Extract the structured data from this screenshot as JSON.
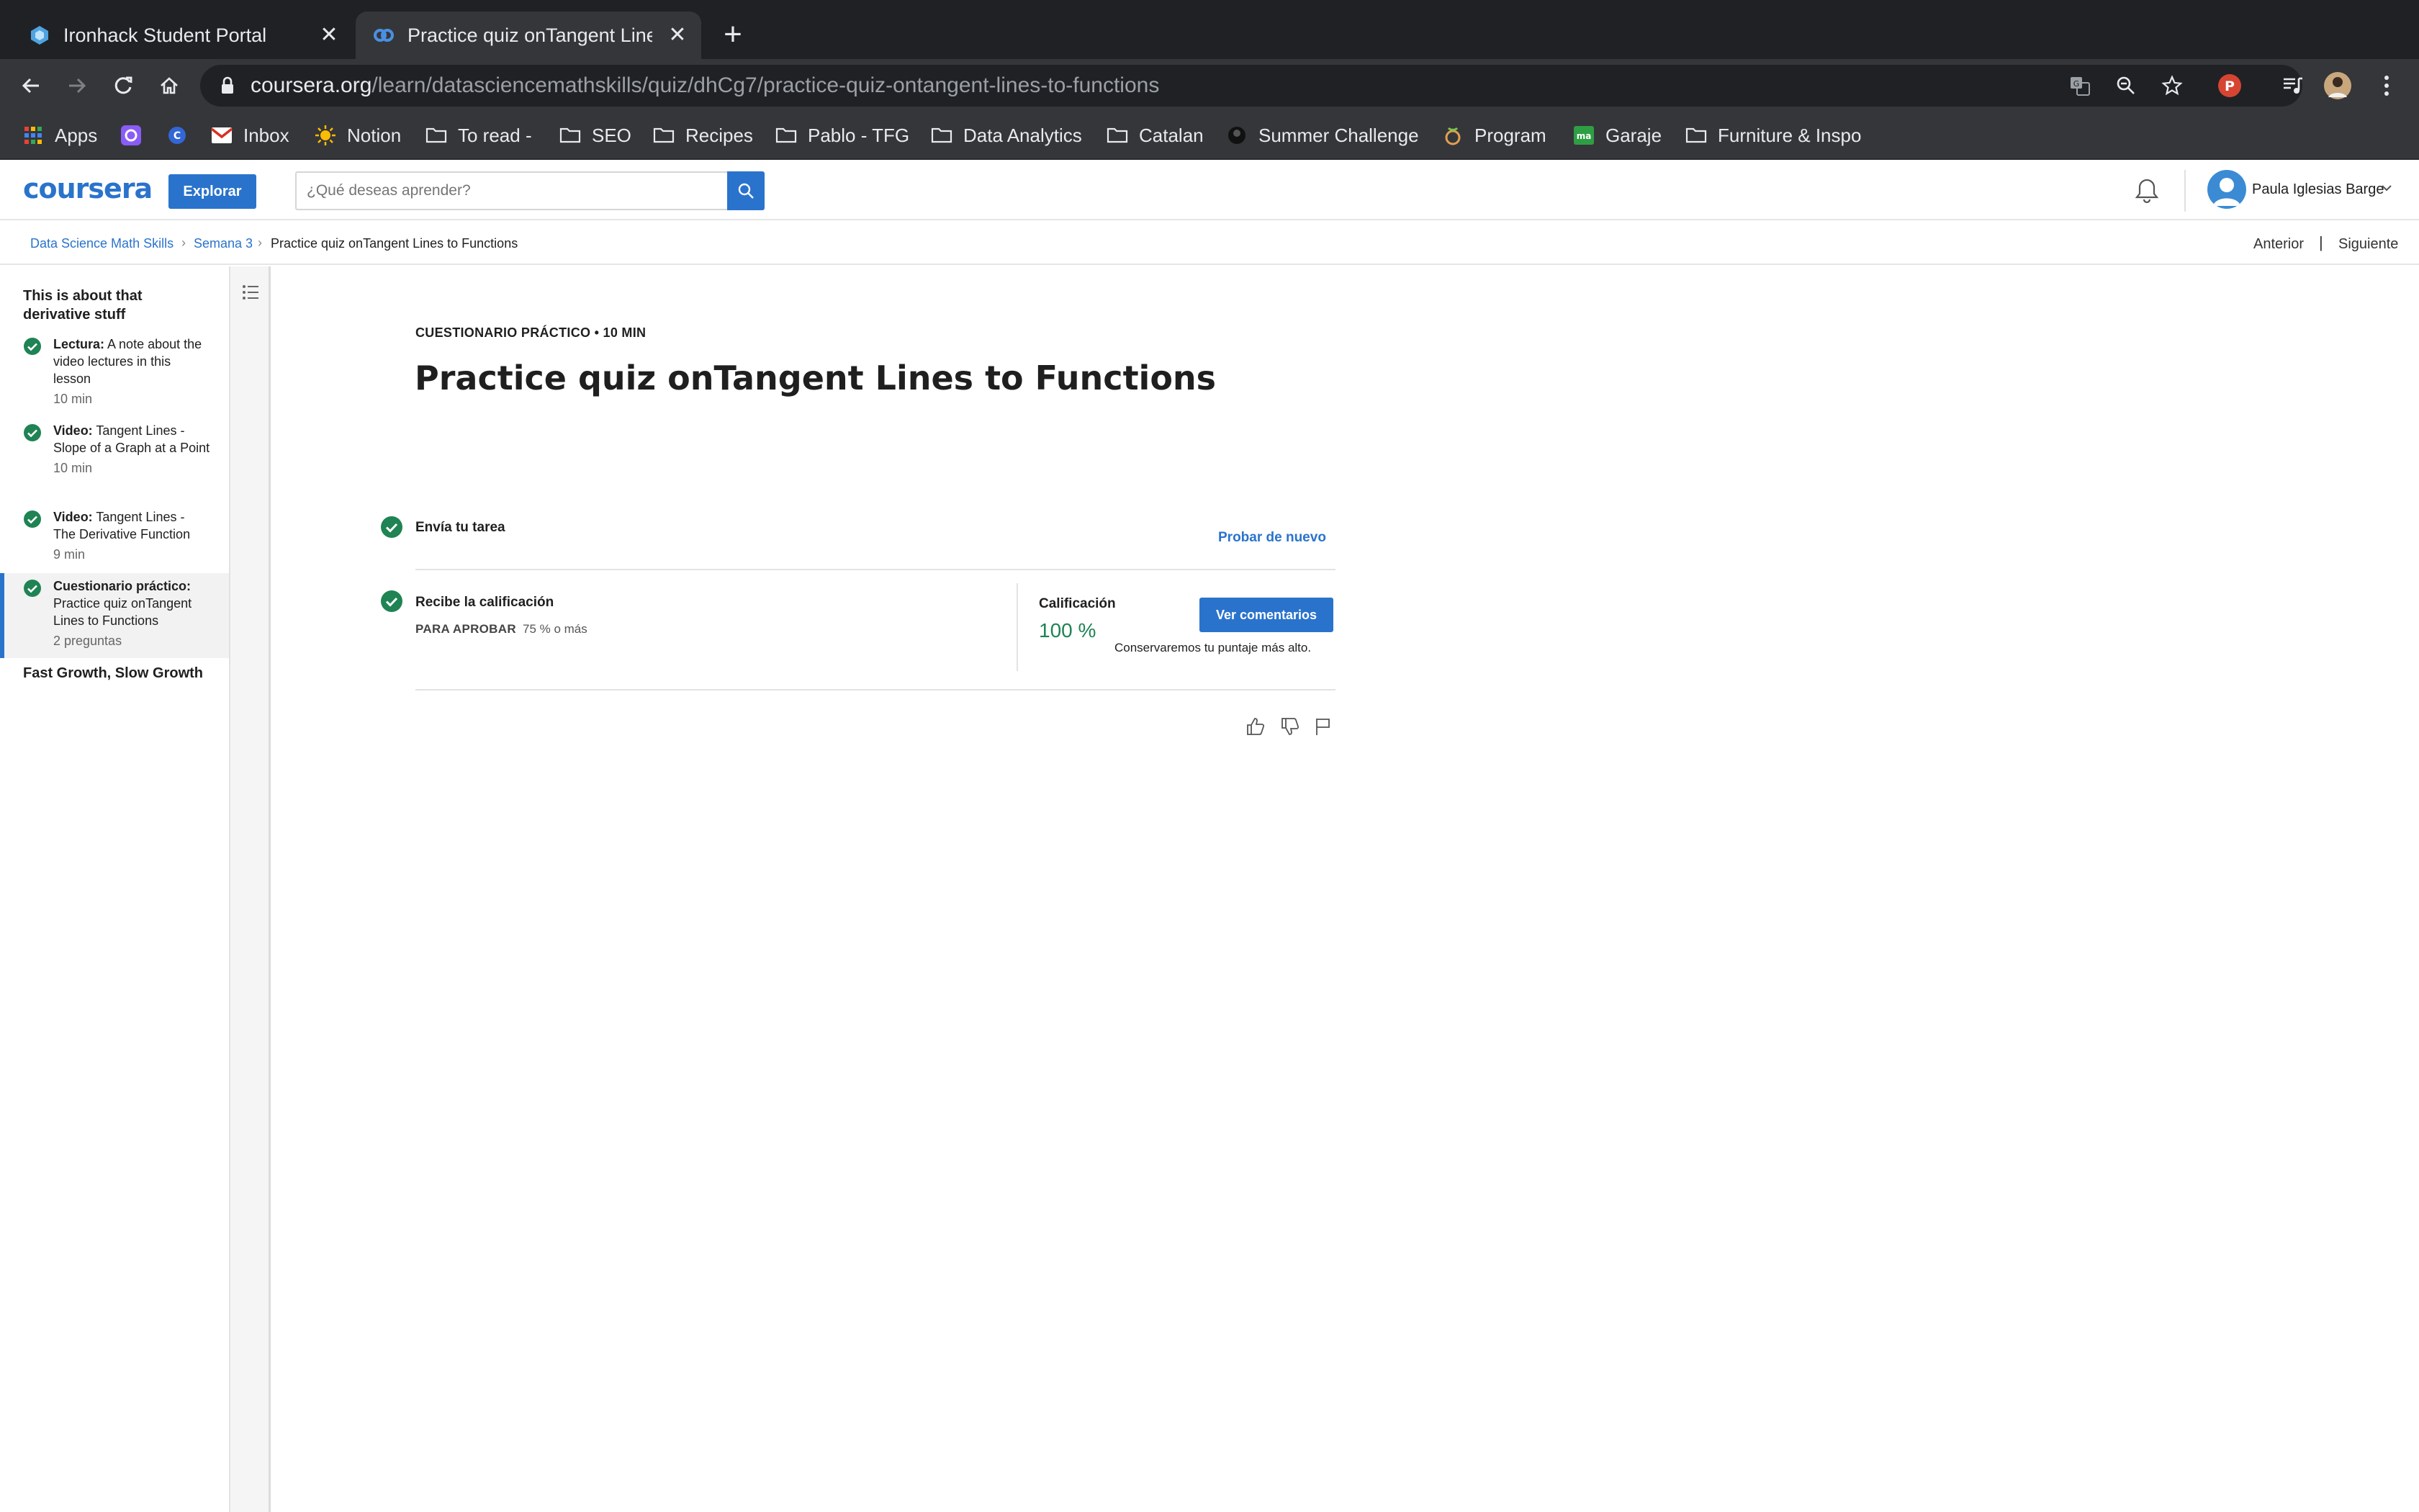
{
  "browser": {
    "tabs": [
      {
        "title": "Ironhack Student Portal",
        "active": false
      },
      {
        "title": "Practice quiz onTangent Lines to Functions",
        "active": true
      }
    ],
    "url_host": "coursera.org",
    "url_path": "/learn/datasciencemathskills/quiz/dhCg7/practice-quiz-ontangent-lines-to-functions",
    "profile_initial": "P",
    "bookmarks": [
      {
        "label": "Apps",
        "icon": "apps-grid-icon"
      },
      {
        "label": "",
        "icon": "app-icon"
      },
      {
        "label": "",
        "icon": "app-icon"
      },
      {
        "label": "Inbox",
        "icon": "gmail-icon"
      },
      {
        "label": "Notion",
        "icon": "sun-icon"
      },
      {
        "label": "To read -",
        "icon": "folder-icon"
      },
      {
        "label": "SEO",
        "icon": "folder-icon"
      },
      {
        "label": "Recipes",
        "icon": "folder-icon"
      },
      {
        "label": "Pablo - TFG",
        "icon": "folder-icon"
      },
      {
        "label": "Data Analytics",
        "icon": "folder-icon"
      },
      {
        "label": "Catalan",
        "icon": "folder-icon"
      },
      {
        "label": "Summer Challenge",
        "icon": "site-icon"
      },
      {
        "label": "Program",
        "icon": "site-icon"
      },
      {
        "label": "Garaje",
        "icon": "site-icon"
      },
      {
        "label": "Furniture & Inspo",
        "icon": "folder-icon"
      }
    ]
  },
  "header": {
    "logo": "coursera",
    "explore_label": "Explorar",
    "search_placeholder": "¿Qué deseas aprender?",
    "user_name": "Paula Iglesias Barge"
  },
  "breadcrumb": {
    "items": [
      "Data Science Math Skills",
      "Semana 3",
      "Practice quiz onTangent Lines to Functions"
    ],
    "prev_label": "Anterior",
    "separator": "|",
    "next_label": "Siguiente"
  },
  "sidebar": {
    "lesson_title": "This is about that derivative stuff",
    "items": [
      {
        "kind": "Lectura:",
        "title": "A note about the video lectures in this lesson",
        "meta": "10 min",
        "completed": true
      },
      {
        "kind": "Video:",
        "title": "Tangent Lines - Slope of a Graph at a Point",
        "meta": "10 min",
        "completed": true
      },
      {
        "kind": "Video:",
        "title": "Tangent Lines - The Derivative Function",
        "meta": "9 min",
        "completed": true
      },
      {
        "kind": "Cuestionario práctico:",
        "title": "Practice quiz onTangent Lines to Functions",
        "meta": "2 preguntas",
        "completed": true,
        "active": true
      }
    ],
    "next_lesson": "Fast Growth, Slow Growth"
  },
  "main": {
    "eyebrow": "CUESTIONARIO PRÁCTICO • 10 MIN",
    "title": "Practice quiz onTangent Lines to Functions",
    "step1_label": "Envía tu tarea",
    "retry_label": "Probar de nuevo",
    "step2_label": "Recibe la calificación",
    "pass_label": "PARA APROBAR",
    "pass_value": "75 % o más",
    "grade_label": "Calificación",
    "grade_value": "100 %",
    "feedback_button": "Ver comentarios",
    "keep_note": "Conservaremos tu puntaje más alto."
  },
  "colors": {
    "accent": "#2a73cc",
    "success": "#1f8354",
    "chrome_dark": "#202124",
    "chrome_toolbar": "#35363a"
  }
}
